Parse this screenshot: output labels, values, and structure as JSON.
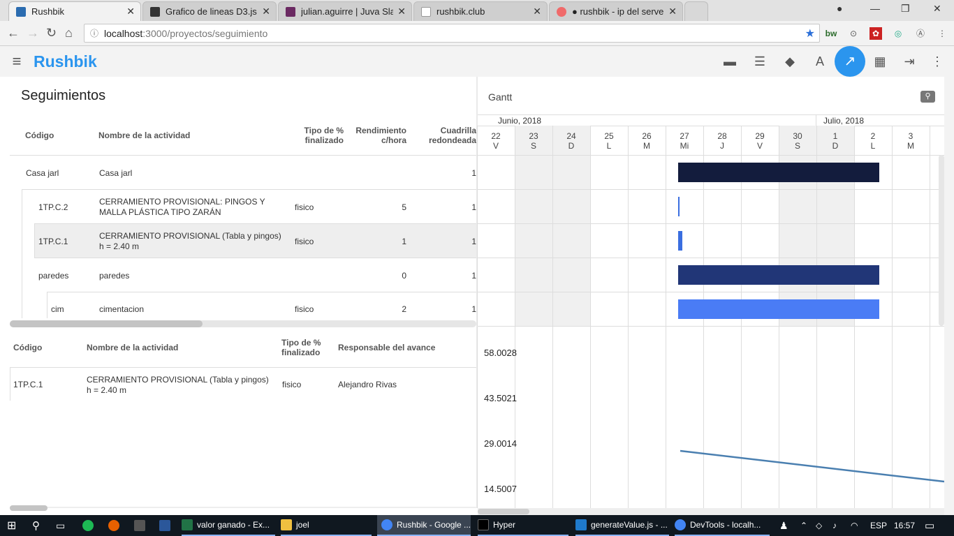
{
  "browser": {
    "tabs": [
      {
        "title": "Rushbik",
        "color": "#2b6cb0"
      },
      {
        "title": "Grafico de lineas D3.js",
        "color": "#333333"
      },
      {
        "title": "julian.aguirre | Juva Slack",
        "color": "#6b2a62"
      },
      {
        "title": "rushbik.club",
        "color": "#9e9e9e"
      },
      {
        "title": "● rushbik - ip del server",
        "color": "#f06a6a"
      }
    ],
    "url_host": "localhost",
    "url_path": ":3000/proyectos/seguimiento"
  },
  "app": {
    "brand": "Rushbik",
    "accent": "#2b95ee"
  },
  "tracking": {
    "title": "Seguimientos",
    "headers": {
      "code": "Código",
      "name": "Nombre de la actividad",
      "type": "Tipo de % finalizado",
      "perf": "Rendimiento c/hora",
      "crew": "Cuadrilla redondeada"
    },
    "rows": [
      {
        "code": "Casa jarl",
        "name": "Casa jarl",
        "type": "",
        "perf": "",
        "crew": "1"
      },
      {
        "code": "1TP.C.2",
        "name": "CERRAMIENTO PROVISIONAL: PINGOS Y MALLA PLÁSTICA TIPO ZARÁN",
        "type": "fisico",
        "perf": "5",
        "crew": "1"
      },
      {
        "code": "1TP.C.1",
        "name": "CERRAMIENTO PROVISIONAL (Tabla y pingos) h = 2.40 m",
        "type": "fisico",
        "perf": "1",
        "crew": "1"
      },
      {
        "code": "paredes",
        "name": "paredes",
        "type": "",
        "perf": "0",
        "crew": "1"
      },
      {
        "code": "cim",
        "name": "cimentacion",
        "type": "fisico",
        "perf": "2",
        "crew": "1"
      }
    ]
  },
  "detail": {
    "headers": {
      "code": "Código",
      "name": "Nombre de la actividad",
      "type": "Tipo de % finalizado",
      "resp": "Responsable del avance"
    },
    "row": {
      "code": "1TP.C.1",
      "name": "CERRAMIENTO PROVISIONAL (Tabla y pingos) h = 2.40 m",
      "type": "fisico",
      "resp": "Alejandro Rivas"
    }
  },
  "gantt": {
    "title": "Gantt",
    "months": [
      "Junio, 2018",
      "Julio, 2018"
    ],
    "days": [
      {
        "n": "22",
        "d": "V"
      },
      {
        "n": "23",
        "d": "S"
      },
      {
        "n": "24",
        "d": "D"
      },
      {
        "n": "25",
        "d": "L"
      },
      {
        "n": "26",
        "d": "M"
      },
      {
        "n": "27",
        "d": "Mi"
      },
      {
        "n": "28",
        "d": "J"
      },
      {
        "n": "29",
        "d": "V"
      },
      {
        "n": "30",
        "d": "S"
      },
      {
        "n": "1",
        "d": "D"
      },
      {
        "n": "2",
        "d": "L"
      },
      {
        "n": "3",
        "d": "M"
      }
    ]
  },
  "chart_data": {
    "type": "line",
    "y_ticks": [
      "58.0028",
      "43.5021",
      "29.0014",
      "14.5007"
    ],
    "series_color": "#4a7fb0"
  },
  "taskbar": {
    "items": [
      "valor ganado - Ex...",
      "joel",
      "Rushbik - Google ...",
      "Hyper",
      "generateValue.js - ...",
      "DevTools - localh..."
    ],
    "lang": "ESP",
    "time": "16:57"
  }
}
